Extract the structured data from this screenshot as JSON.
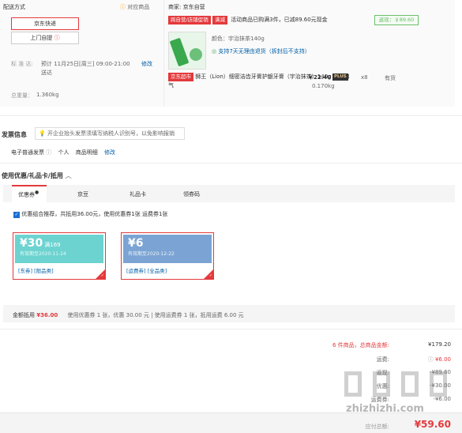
{
  "shipping": {
    "title": "配送方式",
    "info_link": "对应商品",
    "option_selected": "京东快递",
    "option_other": "上门自提",
    "date_label": "标 准 达:",
    "date_value": "预计 11月25日[周三] 09:00-21:00 送达",
    "modify": "修改",
    "weight_label": "总重量：",
    "weight_value": "1.360kg"
  },
  "seller": {
    "label": "商家:",
    "name": "京东自营",
    "promo_tag1": "跨自营/店铺促销",
    "promo_tag2": "满减",
    "promo_text": "活动商品已购满3件，已减89.60元现金",
    "discount": "返现：￥89.60"
  },
  "product": {
    "color": "颜色：宇治抹茶140g",
    "return_policy": "支持7天无理由退货（拆封后不支持）",
    "market_tag": "京东超市",
    "name": "狮王（Lion）细密洁齿牙膏护龈牙膏（宇治抹茶）140g 清新口气",
    "price": "￥22.40",
    "plus": "PLUS",
    "qty": "x8",
    "stock": "有货",
    "weight": "0.170kg"
  },
  "invoice": {
    "title": "发票信息",
    "tip": "开企业抬头发票须填写纳税人识别号，以免影响报销",
    "type": "电子普通发票",
    "who": "个人",
    "detail": "商品明细",
    "modify": "修改"
  },
  "coupons": {
    "section_title": "使用优惠/礼品卡/抵用",
    "tabs": [
      "优惠券",
      "京豆",
      "礼品卡",
      "领券码"
    ],
    "recommend": "优惠组合推荐，共抵用36.00元，使用优惠券1张 运费券1张",
    "items": [
      {
        "amount": "¥30",
        "cond": "满169",
        "date": "有效期至2020-11-24",
        "tags": "[东券] [限品类]",
        "corner": "已选"
      },
      {
        "amount": "¥6",
        "cond": "",
        "date": "有效期至2020-12-22",
        "tags": "[运费券] [全品类]",
        "corner": "已选"
      }
    ],
    "footer_label": "金额抵用",
    "footer_amount": "¥36.00",
    "footer_detail": "使用优惠券 1 张，优惠 30.00 元 | 使用运费券 1 张，抵用运费 6.00 元"
  },
  "summary": {
    "count_text": "6 件商品，总商品金额:",
    "total_goods": "¥179.20",
    "freight_label": "运费:",
    "freight": "¥6.00",
    "row3_label": "返现:",
    "row3_value": "-¥89.60",
    "row4_label": "优惠:",
    "row4_value": "-¥30.00",
    "row5_label": "运费券:",
    "row5_value": "-¥6.00",
    "pay_label": "应付总额:",
    "pay_value": "¥59.60"
  },
  "watermark": "zhizhizhi.com",
  "colors": {
    "accent": "#e4393c",
    "coupon_teal": "#6cd3d0",
    "coupon_blue": "#7ba4d4",
    "link": "#005ea7"
  }
}
